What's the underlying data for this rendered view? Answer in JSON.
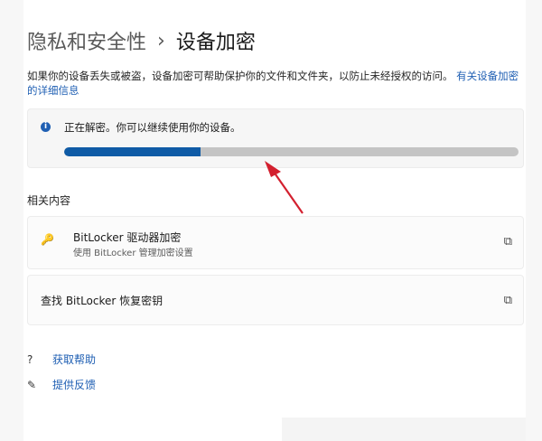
{
  "breadcrumb": {
    "parent": "隐私和安全性",
    "separator": "›",
    "current": "设备加密"
  },
  "description": {
    "text": "如果你的设备丢失或被盗，设备加密可帮助保护你的文件和文件夹，以防止未经授权的访问。",
    "link": "有关设备加密的详细信息"
  },
  "status": {
    "info_icon": "info-icon",
    "text": "正在解密。你可以继续使用你的设备。",
    "progress_percent": 30
  },
  "related": {
    "heading": "相关内容",
    "items": [
      {
        "icon": "key-icon",
        "title": "BitLocker 驱动器加密",
        "subtitle": "使用 BitLocker 管理加密设置",
        "action_icon": "open-external-icon"
      },
      {
        "title": "查找 BitLocker 恢复密钥",
        "action_icon": "open-external-icon"
      }
    ]
  },
  "footer_links": [
    {
      "icon": "help-icon",
      "label": "获取帮助"
    },
    {
      "icon": "feedback-icon",
      "label": "提供反馈"
    }
  ],
  "colors": {
    "accent": "#0f5ba6",
    "link": "#1f5fb3",
    "annotation_arrow": "#d3202f"
  }
}
